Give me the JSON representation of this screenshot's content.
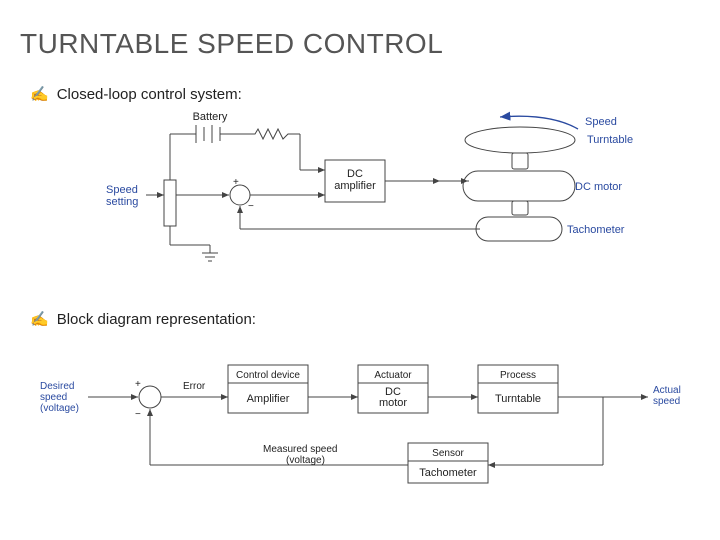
{
  "title": "TURNTABLE SPEED CONTROL",
  "bullets": {
    "b1": "Closed-loop control system:",
    "b2": "Block diagram representation:"
  },
  "fig1": {
    "battery": "Battery",
    "speed_setting": "Speed\nsetting",
    "dc_amp": "DC\namplifier",
    "dc_motor": "DC motor",
    "turntable": "Turntable",
    "tachometer": "Tachometer",
    "speed": "Speed",
    "plus": "+",
    "minus": "−"
  },
  "fig2": {
    "desired": "Desired\nspeed\n(voltage)",
    "plus": "+",
    "minus": "−",
    "error": "Error",
    "control_device": "Control device",
    "amplifier": "Amplifier",
    "actuator": "Actuator",
    "dc_motor": "DC\nmotor",
    "process": "Process",
    "turntable": "Turntable",
    "actual": "Actual\nspeed",
    "measured": "Measured speed\n(voltage)",
    "sensor": "Sensor",
    "tachometer": "Tachometer"
  }
}
